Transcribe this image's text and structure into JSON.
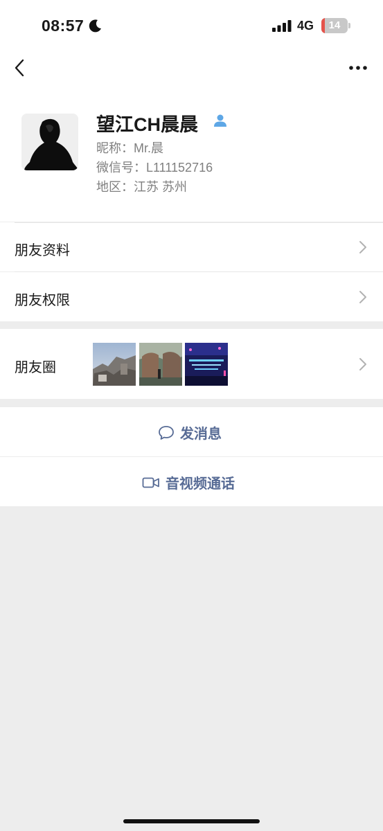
{
  "status_bar": {
    "time": "08:57",
    "network": "4G",
    "battery_level": "14",
    "battery_fraction": 0.14,
    "icons": [
      "moon-icon",
      "signal-icon",
      "battery-icon"
    ]
  },
  "nav": {
    "back_icon": "chevron-left-icon",
    "more_icon": "more-icon"
  },
  "profile": {
    "name": "望江CH晨晨",
    "name_badge_icon": "friend-icon",
    "nickname": "昵称：Mr.晨",
    "wechat_id": "微信号：L111152716",
    "region": "地区：江苏 苏州"
  },
  "menu": {
    "profile_label": "朋友资料",
    "permissions_label": "朋友权限",
    "moments_label": "朋友圈"
  },
  "actions": {
    "message_label": "发消息",
    "call_label": "音视频通话"
  },
  "colors": {
    "link": "#576b95",
    "background": "#ededed",
    "badge": "#5ea7e6",
    "battery_low": "#e5534b"
  }
}
